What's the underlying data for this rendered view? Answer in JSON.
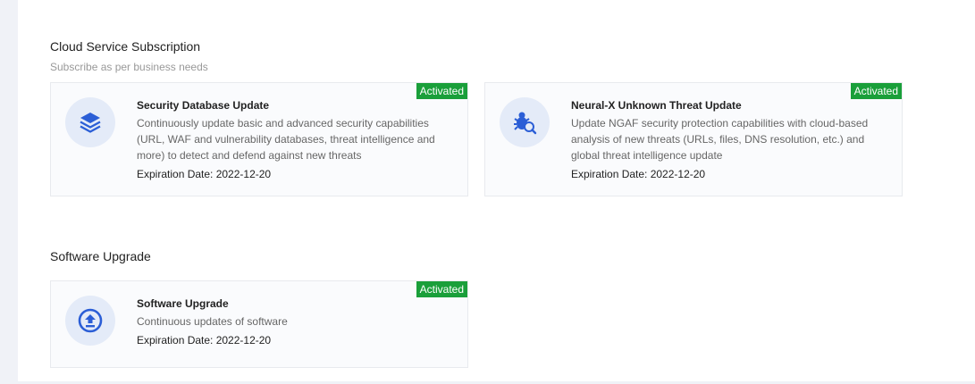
{
  "cloud_section": {
    "title": "Cloud Service Subscription",
    "subtitle": "Subscribe as per business needs",
    "cards": [
      {
        "name": "Security Database Update",
        "description": "Continuously update basic and advanced security capabilities (URL, WAF and vulnerability databases, threat intelligence and more) to detect and defend against new threats",
        "expiration": "Expiration Date: 2022-12-20",
        "status": "Activated",
        "icon": "layers-icon"
      },
      {
        "name": "Neural-X Unknown Threat Update",
        "description": "Update NGAF security protection capabilities with cloud-based analysis of new threats (URLs, files, DNS resolution, etc.) and global threat intelligence update",
        "expiration": "Expiration Date: 2022-12-20",
        "status": "Activated",
        "icon": "bug-search-icon"
      }
    ]
  },
  "software_section": {
    "title": "Software Upgrade",
    "cards": [
      {
        "name": "Software Upgrade",
        "description": "Continuous updates of software",
        "expiration": "Expiration Date: 2022-12-20",
        "status": "Activated",
        "icon": "upload-circle-icon"
      }
    ]
  },
  "colors": {
    "accent": "#2b5ed6",
    "activated": "#1a9f3a",
    "icon_bg": "#e4ebf8"
  }
}
